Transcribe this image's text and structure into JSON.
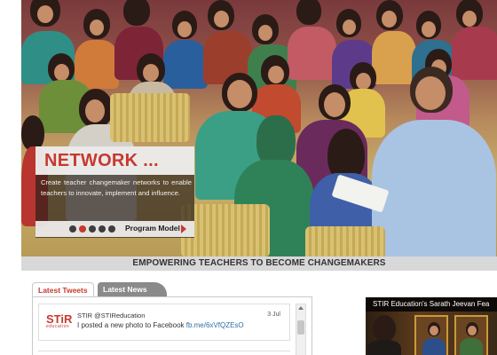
{
  "hero": {
    "title": "NETWORK ...",
    "description": "Create teacher changemaker networks to enable teachers to innovate, implement and influence.",
    "slider_dots": 5,
    "active_dot": 0,
    "cta_label": "Program Model",
    "cta_icon": "arrow-right-icon"
  },
  "tagline": "EMPOWERING TEACHERS TO BECOME CHANGEMAKERS",
  "tabs": [
    {
      "label": "Latest Tweets",
      "active": true
    },
    {
      "label": "Latest News",
      "active": false
    }
  ],
  "tweets": [
    {
      "logo_text": "STiR",
      "logo_subtext": "education",
      "author": "STIR @STIReducation",
      "date": "3 Jul",
      "text": "I posted a new photo to Facebook ",
      "link": "fb.me/6xVfQZEsO"
    },
    {
      "author": "",
      "date": ""
    }
  ],
  "video": {
    "title": "STIR Education's Sarath Jeevan Fea"
  },
  "colors": {
    "accent": "#c7392f",
    "tagline_bg": "#d8d8d8",
    "inactive_tab": "#8a8a8a",
    "link": "#2d6fa6"
  }
}
